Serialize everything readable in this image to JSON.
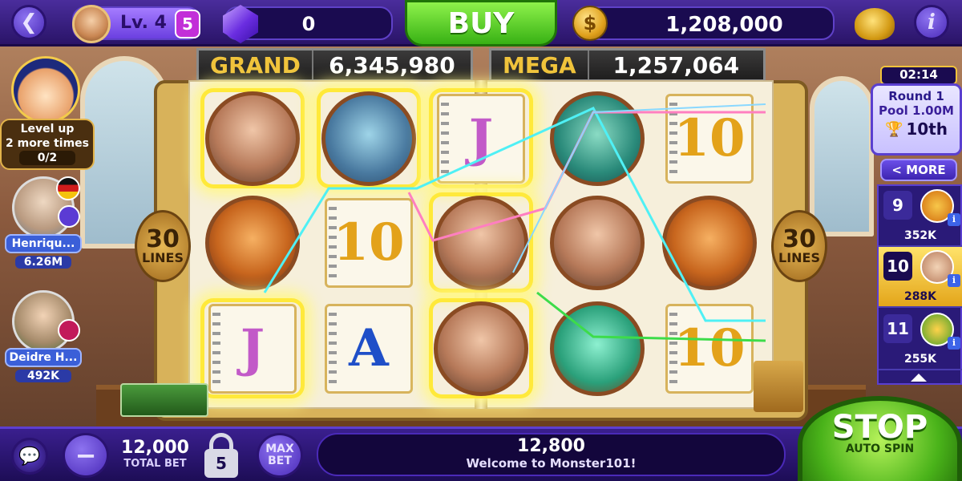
{
  "top": {
    "level": "Lv. 4",
    "level_badge": "5",
    "gems": "0",
    "buy_label": "BUY",
    "coins": "1,208,000"
  },
  "jackpots": {
    "grand_label": "GRAND",
    "grand_value": "6,345,980",
    "mega_label": "MEGA",
    "mega_value": "1,257,064"
  },
  "level_up": {
    "line1": "Level up",
    "line2": "2 more times",
    "progress": "0/2"
  },
  "players": [
    {
      "name": "Henriqu...",
      "value": "6.26M"
    },
    {
      "name": "Deidre H...",
      "value": "492K"
    }
  ],
  "reels": {
    "lines_number": "30",
    "lines_word": "LINES",
    "symbols": [
      "woman",
      "monster-blue",
      "J",
      "monster-green-books",
      "10",
      "orange-monster",
      "10",
      "woman",
      "woman",
      "orange-monster",
      "J",
      "A",
      "woman",
      "sea-monster",
      "10"
    ]
  },
  "tournament": {
    "timer": "02:14",
    "round": "Round 1",
    "pool": "Pool 1.00M",
    "place": "10th",
    "more_label": "< MORE",
    "ranks": [
      {
        "rank": "9",
        "value": "352K"
      },
      {
        "rank": "10",
        "value": "288K"
      },
      {
        "rank": "11",
        "value": "255K"
      }
    ]
  },
  "bottom": {
    "total_bet": "12,000",
    "total_bet_label": "TOTAL BET",
    "lock_level": "5",
    "max_bet_1": "MAX",
    "max_bet_2": "BET",
    "win": "12,800",
    "message": "Welcome to Monster101!",
    "stop_label": "STOP",
    "auto_spin_label": "AUTO SPIN"
  },
  "colors": {
    "accent": "#4a2ab8",
    "buy_green": "#38b114",
    "gold": "#f0c33b"
  }
}
